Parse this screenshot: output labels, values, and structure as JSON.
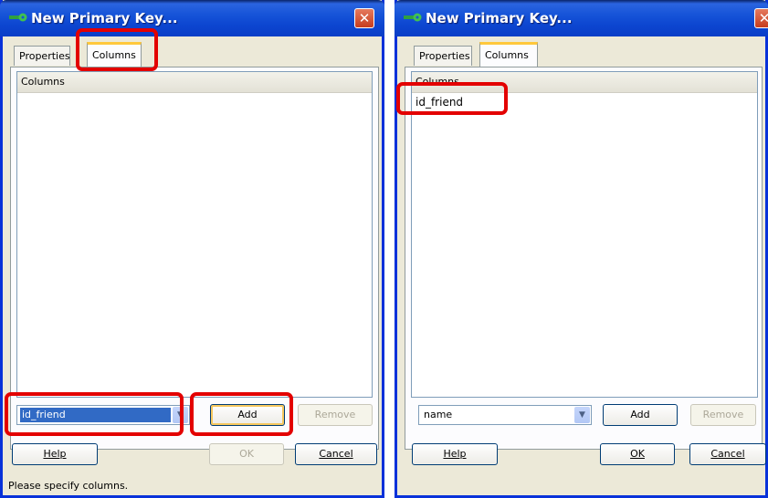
{
  "left_dialog": {
    "title": "New Primary Key...",
    "tabs": [
      "Properties",
      "Columns"
    ],
    "list_header": "Columns",
    "list_items": [],
    "combo_value": "id_friend",
    "add_label": "Add",
    "remove_label": "Remove",
    "help_label": "Help",
    "ok_label": "OK",
    "cancel_label": "Cancel",
    "status": "Please specify columns."
  },
  "right_dialog": {
    "title": "New Primary Key...",
    "tabs": [
      "Properties",
      "Columns"
    ],
    "list_header": "Columns",
    "list_items": [
      "id_friend"
    ],
    "combo_value": "name",
    "add_label": "Add",
    "remove_label": "Remove",
    "help_label": "Help",
    "ok_label": "OK",
    "cancel_label": "Cancel"
  },
  "colors": {
    "highlight": "#e30000",
    "titlebar": "#0a3ec7",
    "selection": "#316ac5"
  }
}
